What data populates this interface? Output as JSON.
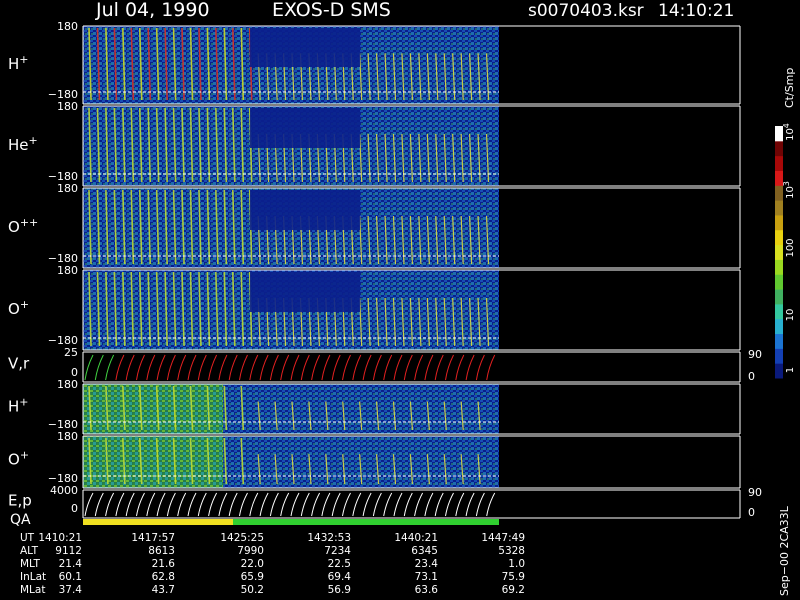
{
  "header": {
    "date": "Jul 04, 1990",
    "mission": "EXOS-D SMS",
    "filename": "s0070403.ksr",
    "time": "14:10:21"
  },
  "colors": {
    "background": "#000000",
    "axis": "#ffffff",
    "fill_blue": "#0a1f8c",
    "spin_curve_a": "#e02020",
    "spin_curve_b": "#40d040",
    "qa_yellow": "#f0e020",
    "qa_green": "#30d030"
  },
  "colorbar": {
    "unit_label": "Ct/Smp",
    "tick_labels": [
      "1",
      "10",
      "100",
      "10",
      "10",
      "10"
    ],
    "tick_exponents": [
      "",
      "",
      "",
      "",
      "3",
      "4"
    ],
    "stops": [
      "#0a1a7c",
      "#1440b4",
      "#1c74d2",
      "#28b0d0",
      "#34c8a0",
      "#40b060",
      "#60c830",
      "#9ad820",
      "#d8e020",
      "#e8d010",
      "#c8a010",
      "#a08020",
      "#806020",
      "#d81818",
      "#a80808",
      "#700404",
      "#ffffff"
    ]
  },
  "panels": [
    {
      "label": "H",
      "sup": "+",
      "y_top": "180",
      "y_bottom": "−180",
      "right_top": "",
      "right_bottom": ""
    },
    {
      "label": "He",
      "sup": "+",
      "y_top": "180",
      "y_bottom": "−180",
      "right_top": "",
      "right_bottom": ""
    },
    {
      "label": "O",
      "sup": "++",
      "y_top": "180",
      "y_bottom": "−180",
      "right_top": "",
      "right_bottom": ""
    },
    {
      "label": "O",
      "sup": "+",
      "y_top": "180",
      "y_bottom": "−180",
      "right_top": "",
      "right_bottom": ""
    },
    {
      "label": "V,r",
      "sup": "",
      "y_top": "25",
      "y_bottom": "0",
      "right_top": "90",
      "right_bottom": "0"
    },
    {
      "label": "H",
      "sup": "+",
      "y_top": "180",
      "y_bottom": "−180",
      "right_top": "",
      "right_bottom": ""
    },
    {
      "label": "O",
      "sup": "+",
      "y_top": "180",
      "y_bottom": "−180",
      "right_top": "",
      "right_bottom": ""
    },
    {
      "label": "E,p",
      "sup": "",
      "y_top": "4000",
      "y_bottom": "0",
      "right_top": "90",
      "right_bottom": "0"
    }
  ],
  "qa_label": "QA",
  "side_note": "Sep−00  2CA33L",
  "footer": {
    "row_labels": [
      "UT",
      "ALT",
      "MLT",
      "InLat",
      "MLat"
    ],
    "columns": [
      [
        "1410:21",
        "9112",
        "21.4",
        "60.1",
        "37.4"
      ],
      [
        "1417:57",
        "8613",
        "21.6",
        "62.8",
        "43.7"
      ],
      [
        "1425:25",
        "7990",
        "22.0",
        "65.9",
        "50.2"
      ],
      [
        "1432:53",
        "7234",
        "22.5",
        "69.4",
        "56.9"
      ],
      [
        "1440:21",
        "6345",
        "23.4",
        "73.1",
        "63.6"
      ],
      [
        "1447:49",
        "5328",
        "1.0",
        "75.9",
        "69.2"
      ]
    ]
  },
  "chart_data": {
    "type": "heatmap",
    "x_ticks_ut": [
      "1410:21",
      "1417:57",
      "1425:25",
      "1432:53",
      "1440:21",
      "1447:49"
    ],
    "data_coverage": "1410:21 to ~1447:49; blank afterwards",
    "colorbar_scale": "log",
    "colorbar_range": [
      1,
      10000
    ],
    "qa_segments": [
      {
        "from": "1410:21",
        "to": "1424:45",
        "color": "#f0e020"
      },
      {
        "from": "1424:45",
        "to": "1447:49",
        "color": "#30d030"
      }
    ]
  }
}
